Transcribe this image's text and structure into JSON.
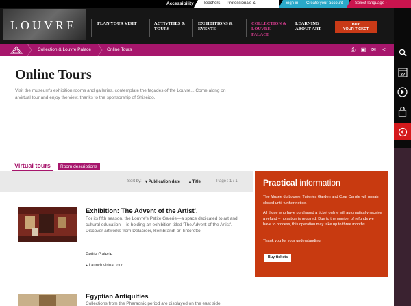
{
  "utility": {
    "accessibility": "Accessibility",
    "teachers": "Teachers",
    "professionals": "Professionals & Associations",
    "sign_in": "Sign in",
    "create_account": "Create your account",
    "select_language": "Select language",
    "select_language_arrow": "›"
  },
  "header": {
    "logo": "LOUVRE",
    "nav": [
      {
        "line1": "PLAN YOUR VISIT",
        "line2": ""
      },
      {
        "line1": "ACTIVITIES &",
        "line2": "TOURS"
      },
      {
        "line1": "EXHIBITIONS &",
        "line2": "EVENTS"
      },
      {
        "line1": "COLLECTION &",
        "line2": "LOUVRE",
        "line3": "PALACE"
      },
      {
        "line1": "LEARNING",
        "line2": "ABOUT ART"
      }
    ],
    "buy_line1": "BUY",
    "buy_line2": "YOUR TICKET"
  },
  "breadcrumb": {
    "item1": "Collection & Louvre Palace",
    "item2": "Online Tours"
  },
  "page": {
    "title": "Online Tours",
    "intro": "Visit the museum's exhibition rooms and galleries, contemplate the façades of the Louvre... Come along on a virtual tour and enjoy the view, thanks to the sponsorship of Shiseido."
  },
  "tabs": {
    "active": "Virtual tours",
    "other": "Room descriptions"
  },
  "sort": {
    "label": "Sort by:",
    "publication": "▾ Publication date",
    "title": "▴ Title",
    "page": "Page :   1 / 1"
  },
  "items": [
    {
      "title": "Exhibition: The Advent of the Artist'.",
      "desc": "For its fifth season, the Louvre's Petite Galerie—a space dedicated to art and cultural education— is holding an exhibition titled 'The Advent of the Artist'. Discover artworks from Delacroix, Rembrandt or Tintoretto.",
      "sub": "Petite Galerie",
      "launch": "▸ Launch virtual tour"
    },
    {
      "title": "Egyptian Antiquities",
      "desc": "Collections from the Pharaonic period are displayed on the east side"
    }
  ],
  "practical": {
    "title_bold": "Practical",
    "title_rest": " information",
    "p1": "The Musée du Louvre, Tuileries Garden and Cour Carrée will remain closed until further notice.",
    "p2": "All those who have purchased a ticket online will automatically receive a refund – no action is required. Due to the number of refunds we have to process, this operation may take up to three months.",
    "p3": "Thank you for your understanding.",
    "button": "Buy tickets"
  },
  "sidebar": {
    "calendar_day": "27"
  },
  "colors": {
    "magenta": "#a7166c",
    "practical_orange": "#c83a10",
    "buy_orange": "#c93a17",
    "signin_blue": "#2aa9c9",
    "language_red": "#c9144e"
  }
}
